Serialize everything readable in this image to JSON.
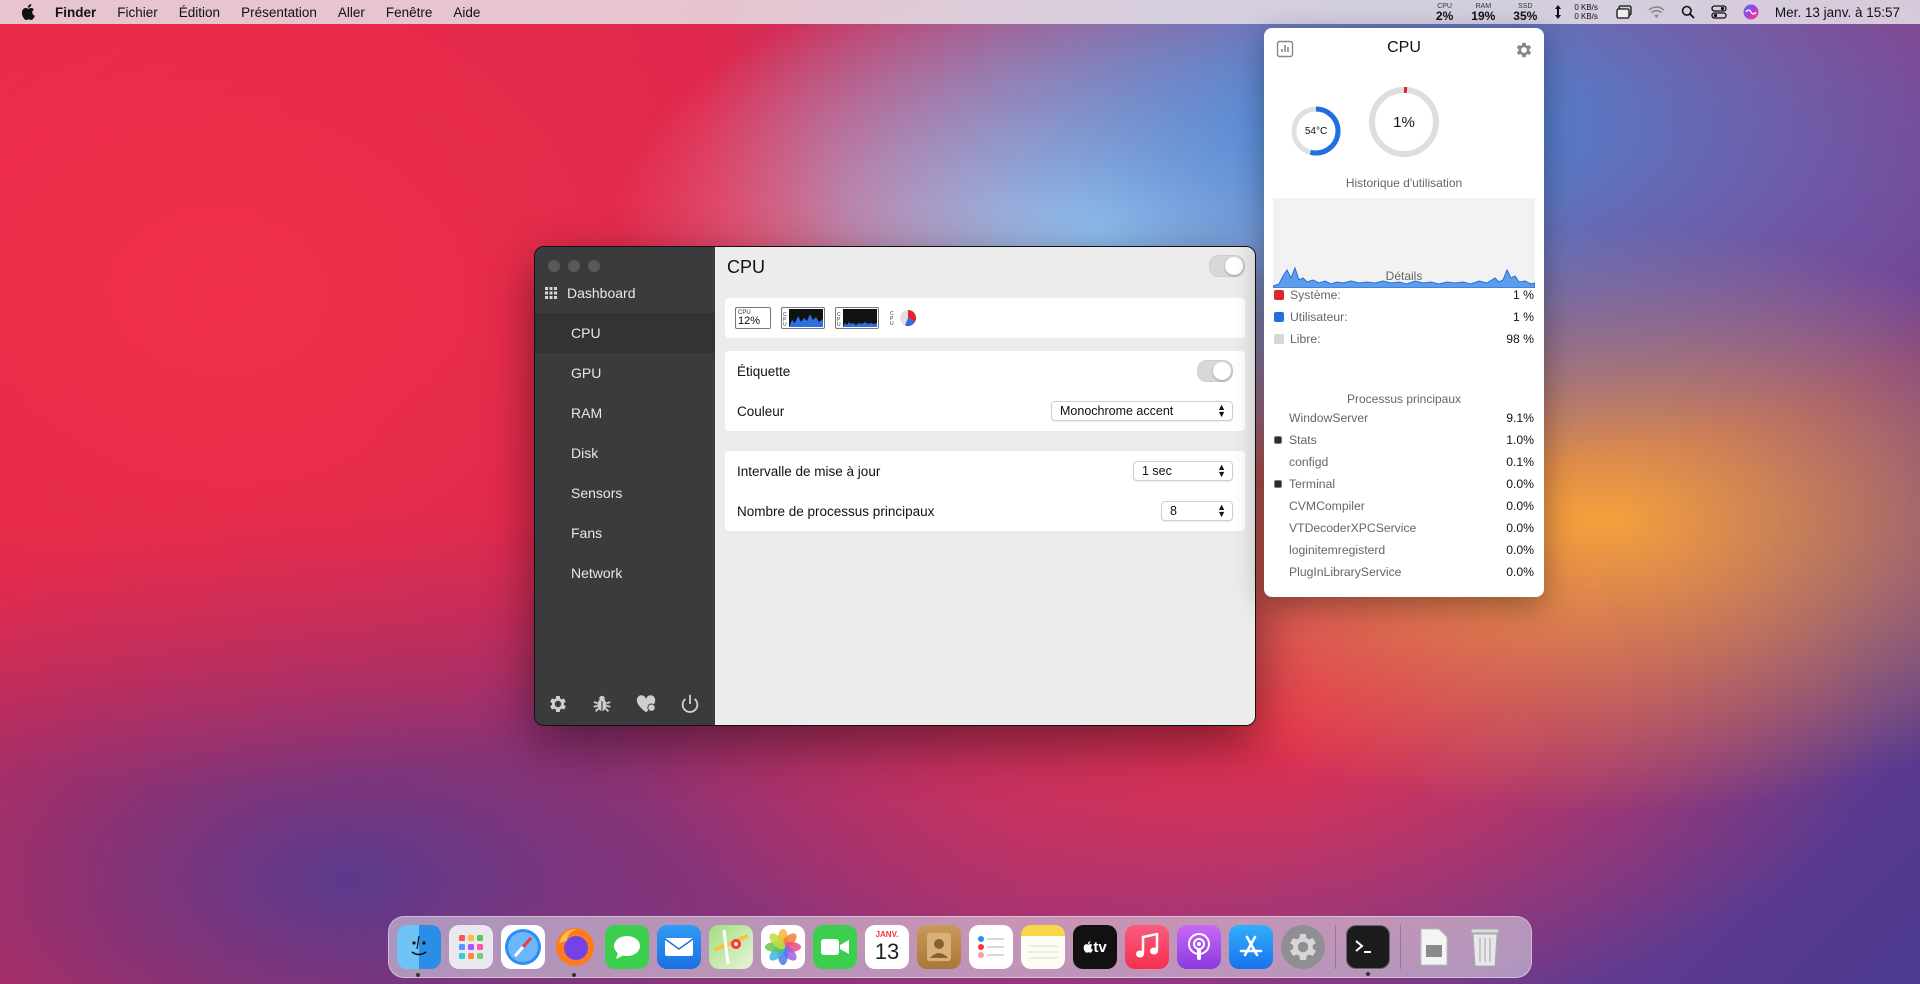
{
  "menubar": {
    "app": "Finder",
    "items": [
      "Fichier",
      "Édition",
      "Présentation",
      "Aller",
      "Fenêtre",
      "Aide"
    ],
    "stats": [
      {
        "key": "CPU",
        "value": "2%"
      },
      {
        "key": "RAM",
        "value": "19%"
      },
      {
        "key": "SSD",
        "value": "35%"
      }
    ],
    "net_up": "0 KB/s",
    "net_down": "0 KB/s",
    "clock": "Mer. 13 janv. à  15:57"
  },
  "window": {
    "sidebar": {
      "dashboard": "Dashboard",
      "items": [
        "CPU",
        "GPU",
        "RAM",
        "Disk",
        "Sensors",
        "Fans",
        "Network"
      ],
      "active": "CPU"
    },
    "title": "CPU",
    "widgets": {
      "cpu_label": "CPU",
      "cpu_value": "12%"
    },
    "label_row": "Étiquette",
    "color_row": {
      "label": "Couleur",
      "value": "Monochrome accent"
    },
    "interval_row": {
      "label": "Intervalle de mise à jour",
      "value": "1 sec"
    },
    "procs_row": {
      "label": "Nombre de processus principaux",
      "value": "8"
    }
  },
  "popover": {
    "title": "CPU",
    "temperature": "54°C",
    "temperature_level": 0.54,
    "usage": "1%",
    "usage_level": 0.01,
    "history_title": "Historique d'utilisation",
    "details_title": "Détails",
    "details": [
      {
        "label": "Système:",
        "value": "1 %",
        "color": "#e0262d"
      },
      {
        "label": "Utilisateur:",
        "value": "1 %",
        "color": "#1f6fe0"
      },
      {
        "label": "Libre:",
        "value": "98 %",
        "color": "#d6d6d6"
      }
    ],
    "processes_title": "Processus principaux",
    "processes": [
      {
        "name": "WindowServer",
        "value": "9.1%",
        "icon": false
      },
      {
        "name": "Stats",
        "value": "1.0%",
        "icon": true
      },
      {
        "name": "configd",
        "value": "0.1%",
        "icon": false
      },
      {
        "name": "Terminal",
        "value": "0.0%",
        "icon": true
      },
      {
        "name": "CVMCompiler",
        "value": "0.0%",
        "icon": false
      },
      {
        "name": "VTDecoderXPCService",
        "value": "0.0%",
        "icon": false
      },
      {
        "name": "loginitemregisterd",
        "value": "0.0%",
        "icon": false
      },
      {
        "name": "PlugInLibraryService",
        "value": "0.0%",
        "icon": false
      }
    ]
  },
  "dock": {
    "calendar_month": "JANV.",
    "calendar_day": "13",
    "tv_label": "tv",
    "apps": [
      "finder-icon",
      "launchpad-icon",
      "safari-icon",
      "firefox-icon",
      "messages-icon",
      "mail-icon",
      "maps-icon",
      "photos-icon",
      "facetime-icon",
      "calendar-icon",
      "contacts-icon",
      "reminders-icon",
      "notes-icon",
      "apple-tv-icon",
      "music-icon",
      "podcasts-icon",
      "app-store-icon",
      "system-preferences-icon",
      "terminal-icon",
      "preview-icon",
      "trash-icon"
    ]
  },
  "colors": {
    "accent": "#1f6fe0",
    "sidebar": "#3b3b3d",
    "system": "#e0262d"
  }
}
